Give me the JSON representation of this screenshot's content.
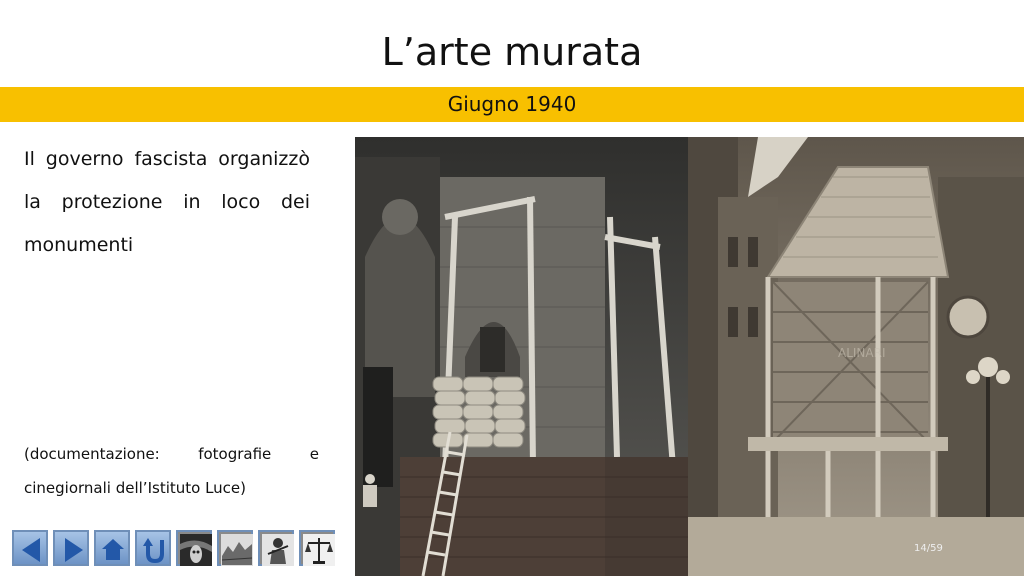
{
  "slide": {
    "title": "L’arte murata",
    "subtitle": "Giugno 1940",
    "paragraph_lines": [
      [
        "Il",
        "governo",
        "fascista",
        "organizzò"
      ],
      [
        "la",
        "protezione",
        "in",
        "loco",
        "dei"
      ],
      [
        "monumenti"
      ]
    ],
    "note_line1": [
      "(documentazione:",
      "fotografie",
      "e"
    ],
    "note_line2": "cinegiornali dell’Istituto Luce)",
    "page_number": "14/59",
    "watermark": "ALINARI"
  },
  "nav": {
    "buttons": [
      {
        "name": "previous-slide-button",
        "icon": "left-arrow-icon"
      },
      {
        "name": "next-slide-button",
        "icon": "right-arrow-icon"
      },
      {
        "name": "home-button",
        "icon": "house-icon"
      },
      {
        "name": "return-button",
        "icon": "u-turn-icon"
      },
      {
        "name": "scream-painting-button",
        "icon": "painting-icon"
      },
      {
        "name": "landscape-drawing-button",
        "icon": "drawing-icon"
      },
      {
        "name": "figure-illustration-button",
        "icon": "figure-icon"
      },
      {
        "name": "justice-button",
        "icon": "scales-icon"
      }
    ]
  },
  "colors": {
    "band": "#f8c000",
    "nav_blue": "#3e6fb0"
  }
}
